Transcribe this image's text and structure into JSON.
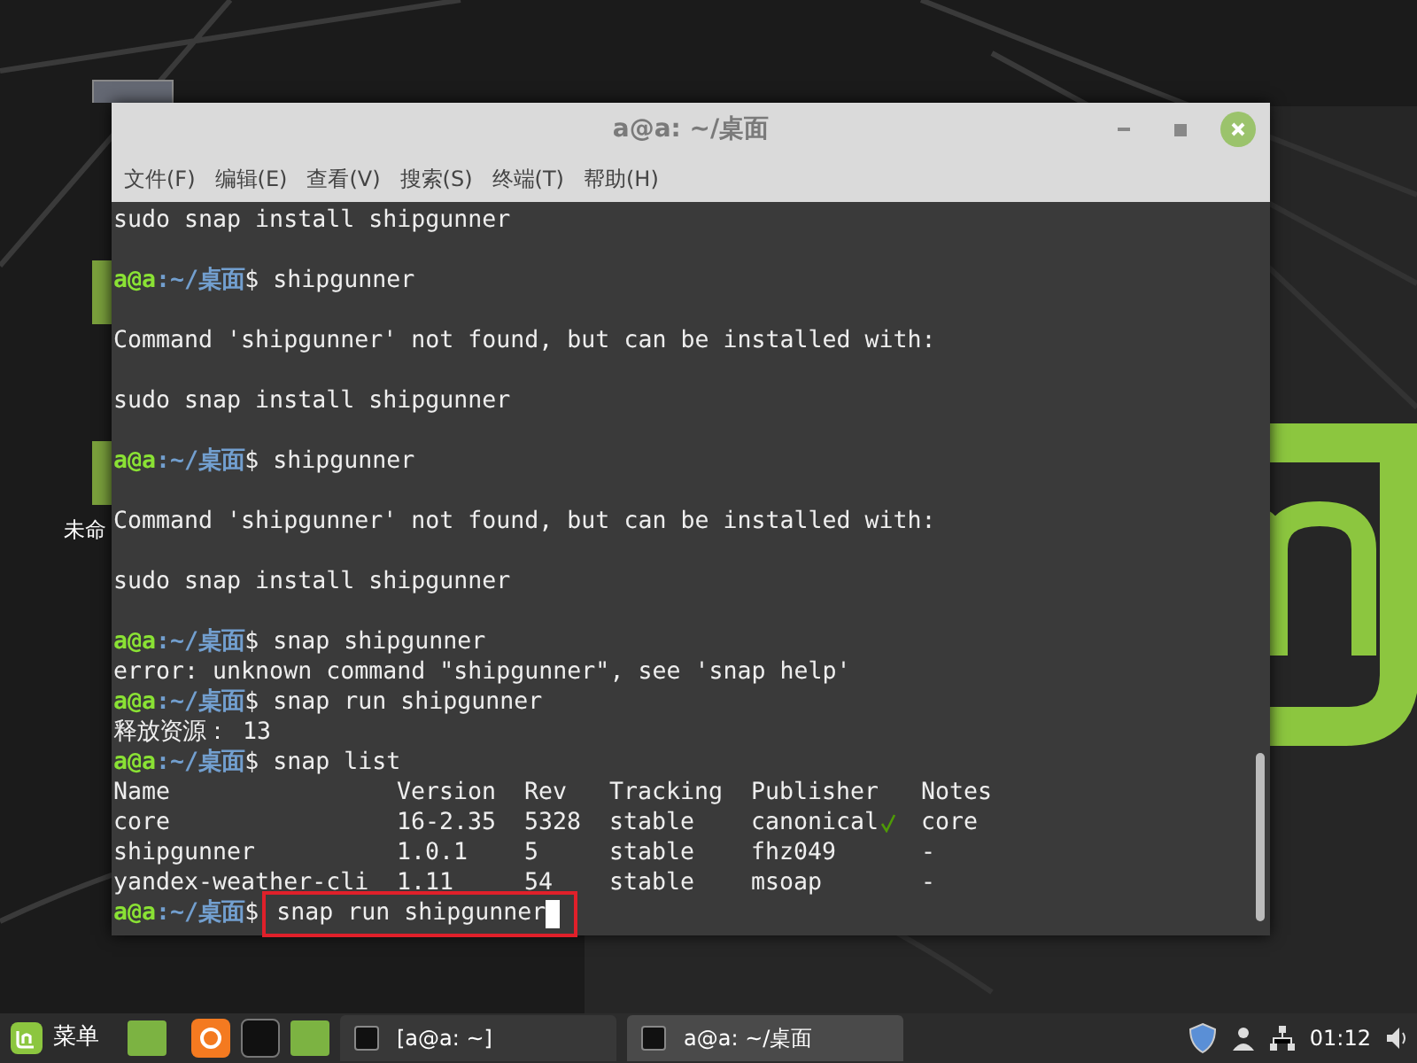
{
  "desktop_icons": [
    {
      "label": "未命"
    }
  ],
  "window": {
    "title": "a@a: ~/桌面",
    "menu": [
      "文件(F)",
      "编辑(E)",
      "查看(V)",
      "搜索(S)",
      "终端(T)",
      "帮助(H)"
    ]
  },
  "terminal": {
    "lines": [
      {
        "kind": "output",
        "text": "sudo snap install shipgunner"
      },
      {
        "kind": "blank"
      },
      {
        "kind": "prompt",
        "user": "a@a",
        "path": ":~/桌面",
        "sign": "$",
        "command": "shipgunner",
        "highlighted": false
      },
      {
        "kind": "blank"
      },
      {
        "kind": "output",
        "text": "Command 'shipgunner' not found, but can be installed with:"
      },
      {
        "kind": "blank"
      },
      {
        "kind": "output",
        "text": "sudo snap install shipgunner"
      },
      {
        "kind": "blank"
      },
      {
        "kind": "prompt",
        "user": "a@a",
        "path": ":~/桌面",
        "sign": "$",
        "command": "shipgunner",
        "highlighted": false
      },
      {
        "kind": "blank"
      },
      {
        "kind": "output",
        "text": "Command 'shipgunner' not found, but can be installed with:"
      },
      {
        "kind": "blank"
      },
      {
        "kind": "output",
        "text": "sudo snap install shipgunner"
      },
      {
        "kind": "blank"
      },
      {
        "kind": "prompt",
        "user": "a@a",
        "path": ":~/桌面",
        "sign": "$",
        "command": "snap shipgunner",
        "highlighted": false
      },
      {
        "kind": "output",
        "text": "error: unknown command \"shipgunner\", see 'snap help'"
      },
      {
        "kind": "prompt",
        "user": "a@a",
        "path": ":~/桌面",
        "sign": "$",
        "command": "snap run shipgunner",
        "highlighted": false
      },
      {
        "kind": "output",
        "text": "释放资源： 13"
      },
      {
        "kind": "prompt",
        "user": "a@a",
        "path": ":~/桌面",
        "sign": "$",
        "command": "snap list",
        "highlighted": false
      },
      {
        "kind": "table",
        "columns": [
          "Name",
          "Version",
          "Rev",
          "Tracking",
          "Publisher",
          "Notes"
        ],
        "rows": [
          {
            "cells": [
              "core",
              "16-2.35",
              "5328",
              "stable",
              "canonical",
              "core"
            ],
            "verified": true
          },
          {
            "cells": [
              "shipgunner",
              "1.0.1",
              "5",
              "stable",
              "fhz049",
              "-"
            ],
            "verified": false
          },
          {
            "cells": [
              "yandex-weather-cli",
              "1.11",
              "54",
              "stable",
              "msoap",
              "-"
            ],
            "verified": false
          }
        ]
      },
      {
        "kind": "prompt",
        "user": "a@a",
        "path": ":~/桌面",
        "sign": "$",
        "command": "snap run shipgunner",
        "highlighted": true
      }
    ]
  },
  "taskbar": {
    "menu_label": "菜单",
    "windows": [
      {
        "label": "[a@a: ~]",
        "selected": false
      },
      {
        "label": "a@a: ~/桌面",
        "selected": true
      }
    ],
    "clock": "01:12"
  }
}
